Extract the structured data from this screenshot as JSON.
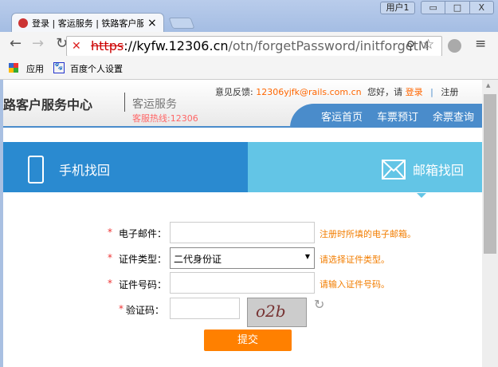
{
  "window": {
    "user_label": "用户1",
    "minimize": "▭",
    "maximize": "□",
    "close": "X"
  },
  "tab": {
    "title": "登录 | 客运服务 | 铁路客户服务中心",
    "close": "×"
  },
  "address": {
    "scheme": "https",
    "host": "://kyfw.12306.cn",
    "path": "/otn/forgetPassword/initforgetM"
  },
  "bookmarks": [
    {
      "label": "应用"
    },
    {
      "label": "百度个人设置"
    }
  ],
  "header": {
    "logo": "路客户服务中心",
    "sub": "客运服务",
    "hotline": "客服热线:12306",
    "feedback_label": "意见反馈:",
    "feedback_email": "12306yjfk@rails.com.cn",
    "greeting": "您好，请",
    "login": "登录",
    "sep": "|",
    "register": "注册",
    "nav": [
      "客运首页",
      "车票预订",
      "余票查询"
    ]
  },
  "tabs": {
    "phone": "手机找回",
    "email": "邮箱找回"
  },
  "form": {
    "email": {
      "label": "电子邮件：",
      "value": "",
      "hint": "注册时所填的电子邮箱。"
    },
    "idtype": {
      "label": "证件类型：",
      "value": "二代身份证",
      "hint": "请选择证件类型。"
    },
    "idno": {
      "label": "证件号码：",
      "value": "",
      "hint": "请输入证件号码。"
    },
    "captcha": {
      "label": "验证码：",
      "value": "",
      "image_text": "o2b"
    },
    "required": "*",
    "submit": "提交"
  },
  "colors": {
    "primary_tab": "#2a8ad0",
    "secondary_tab": "#63c5e6",
    "accent": "#ff8000"
  }
}
